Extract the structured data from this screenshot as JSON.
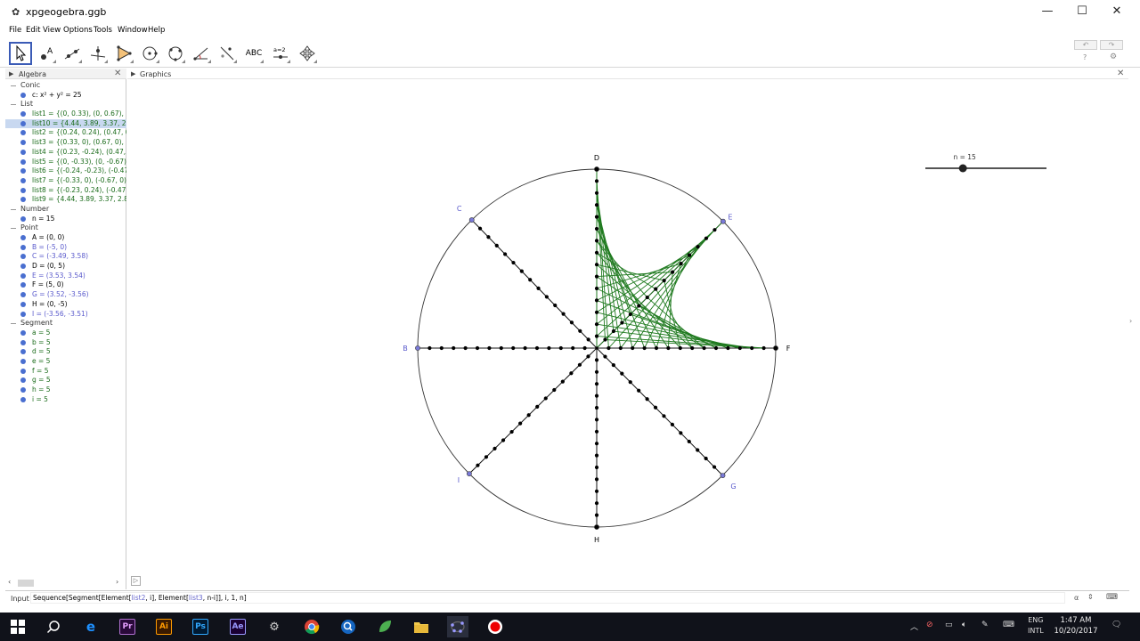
{
  "window": {
    "title": "xpgeogebra.ggb",
    "minimize": "—",
    "maximize": "☐",
    "close": "✕"
  },
  "menu": [
    "File",
    "Edit",
    "View",
    "Options",
    "Tools",
    "Window",
    "Help"
  ],
  "toolbar": {
    "tools": [
      "move-tool",
      "point-tool",
      "line-tool",
      "perpendicular-tool",
      "polygon-tool",
      "circle-tool",
      "circle-3pt-tool",
      "angle-tool",
      "reflect-tool",
      "text-tool",
      "slider-tool",
      "move-view-tool"
    ],
    "text_tool_label": "ABC",
    "slider_tool_label": "a=2",
    "undo": "↶",
    "redo": "↷",
    "help": "?",
    "settings": "⚙"
  },
  "algebra": {
    "title": "Algebra",
    "close": "✕",
    "groups": [
      {
        "name": "Conic",
        "items": [
          {
            "text": "c: x² + y² = 25",
            "color": "#000000",
            "style": "black"
          }
        ]
      },
      {
        "name": "List",
        "items": [
          {
            "text": "list1 = {(0, 0.33), (0, 0.67), (0",
            "color": "#1a6b1a",
            "style": "green"
          },
          {
            "text": "list10 = {4.44, 3.89, 3.37, 2.8",
            "color": "#1a6b1a",
            "style": "green sel"
          },
          {
            "text": "list2 = {(0.24, 0.24), (0.47, 0.",
            "color": "#1a6b1a",
            "style": "green"
          },
          {
            "text": "list3 = {(0.33, 0), (0.67, 0), (1",
            "color": "#1a6b1a",
            "style": "green"
          },
          {
            "text": "list4 = {(0.23, -0.24), (0.47, -(",
            "color": "#1a6b1a",
            "style": "green"
          },
          {
            "text": "list5 = {(0, -0.33), (0, -0.67), (",
            "color": "#1a6b1a",
            "style": "green"
          },
          {
            "text": "list6 = {(-0.24, -0.23), (-0.47, ",
            "color": "#1a6b1a",
            "style": "green"
          },
          {
            "text": "list7 = {(-0.33, 0), (-0.67, 0), (",
            "color": "#1a6b1a",
            "style": "green"
          },
          {
            "text": "list8 = {(-0.23, 0.24), (-0.47, (",
            "color": "#1a6b1a",
            "style": "green"
          },
          {
            "text": "list9 = {4.44, 3.89, 3.37, 2.88",
            "color": "#1a6b1a",
            "style": "green"
          }
        ]
      },
      {
        "name": "Number",
        "items": [
          {
            "text": "n = 15",
            "color": "#000000",
            "style": "black"
          }
        ]
      },
      {
        "name": "Point",
        "items": [
          {
            "text": "A = (0, 0)",
            "color": "#000000",
            "style": "black"
          },
          {
            "text": "B = (-5, 0)",
            "color": "#5a5acc",
            "style": "blue"
          },
          {
            "text": "C = (-3.49, 3.58)",
            "color": "#5a5acc",
            "style": "blue"
          },
          {
            "text": "D = (0, 5)",
            "color": "#000000",
            "style": "black"
          },
          {
            "text": "E = (3.53, 3.54)",
            "color": "#5a5acc",
            "style": "blue"
          },
          {
            "text": "F = (5, 0)",
            "color": "#000000",
            "style": "black"
          },
          {
            "text": "G = (3.52, -3.56)",
            "color": "#5a5acc",
            "style": "blue"
          },
          {
            "text": "H = (0, -5)",
            "color": "#000000",
            "style": "black"
          },
          {
            "text": "I = (-3.56, -3.51)",
            "color": "#5a5acc",
            "style": "blue"
          }
        ]
      },
      {
        "name": "Segment",
        "items": [
          {
            "text": "a = 5",
            "color": "#1a6b1a",
            "style": "black"
          },
          {
            "text": "b = 5",
            "color": "#1a6b1a",
            "style": "black"
          },
          {
            "text": "d = 5",
            "color": "#1a6b1a",
            "style": "black"
          },
          {
            "text": "e = 5",
            "color": "#1a6b1a",
            "style": "black"
          },
          {
            "text": "f = 5",
            "color": "#1a6b1a",
            "style": "black"
          },
          {
            "text": "g = 5",
            "color": "#1a6b1a",
            "style": "black"
          },
          {
            "text": "h = 5",
            "color": "#1a6b1a",
            "style": "black"
          },
          {
            "text": "i = 5",
            "color": "#1a6b1a",
            "style": "black"
          }
        ]
      }
    ]
  },
  "graphics": {
    "title": "Graphics",
    "close": "✕",
    "radius": 5,
    "n": 15,
    "slider_label": "n = 15",
    "slider_value_fraction": 0.31,
    "points": [
      {
        "label": "D",
        "x": 0,
        "y": 5,
        "color": "#000000"
      },
      {
        "label": "E",
        "x": 3.53,
        "y": 3.54,
        "color": "#5a5acc"
      },
      {
        "label": "F",
        "x": 5,
        "y": 0,
        "color": "#000000"
      },
      {
        "label": "G",
        "x": 3.52,
        "y": -3.56,
        "color": "#5a5acc"
      },
      {
        "label": "H",
        "x": 0,
        "y": -5,
        "color": "#000000"
      },
      {
        "label": "I",
        "x": -3.56,
        "y": -3.51,
        "color": "#5a5acc"
      },
      {
        "label": "B",
        "x": -5,
        "y": 0,
        "color": "#5a5acc"
      },
      {
        "label": "C",
        "x": -3.49,
        "y": 3.58,
        "color": "#5a5acc"
      }
    ],
    "point_color": "#000000",
    "string_art_color": "#1f7a1f",
    "circle_color": "#333333"
  },
  "input": {
    "label": "Input",
    "value_parts": [
      {
        "t": "Sequence[Segment[Element[",
        "hl": false
      },
      {
        "t": "list2",
        "hl": true
      },
      {
        "t": ", i], Element[",
        "hl": false
      },
      {
        "t": "list3",
        "hl": true
      },
      {
        "t": ", n-i]]",
        "hl": false
      },
      {
        "t": ", i, 1, n]",
        "hl": false
      }
    ],
    "alpha": "α",
    "spin": "⇕",
    "keyboard": "⌨"
  },
  "taskbar": {
    "lang_top": "ENG",
    "lang_bottom": "INTL",
    "time": "1:47 AM",
    "date": "10/20/2017"
  }
}
